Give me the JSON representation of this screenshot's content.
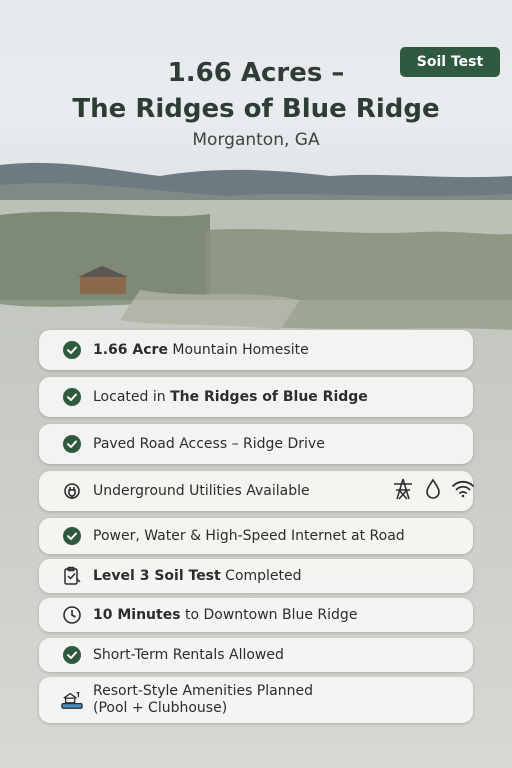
{
  "badge": "Soil Test",
  "title_line1": "1.66 Acres –",
  "title_line2": "The Ridges of Blue Ridge",
  "location": "Morganton, GA",
  "features": [
    {
      "bold": "1.66 Acre",
      "text": " Mountain Homesite",
      "icon": "check-circle-icon"
    },
    {
      "pre": "Located in ",
      "bold": "The Ridges of Blue Ridge",
      "icon": "check-circle-icon"
    },
    {
      "text": "Paved Road Access – Ridge Drive",
      "icon": "check-circle-icon"
    },
    {
      "text": "Underground Utilities Available",
      "icon": "utility-plug-icon",
      "extra_icons": [
        "power-tower-icon",
        "water-drop-icon",
        "wifi-icon"
      ]
    },
    {
      "text": "Power, Water & High-Speed Internet at Road",
      "icon": "check-circle-icon"
    },
    {
      "bold": "Level 3 Soil Test",
      "text": " Completed",
      "icon": "clipboard-check-icon"
    },
    {
      "bold": "10 Minutes",
      "text": " to Downtown Blue Ridge",
      "icon": "clock-icon"
    },
    {
      "text": "Short-Term Rentals Allowed",
      "icon": "check-circle-icon"
    },
    {
      "line1": "Resort-Style Amenities Planned",
      "line2": "(Pool + Clubhouse)",
      "icon": "pool-icon"
    }
  ],
  "colors": {
    "accent": "#2f5a3f",
    "title": "#2f3b35"
  }
}
